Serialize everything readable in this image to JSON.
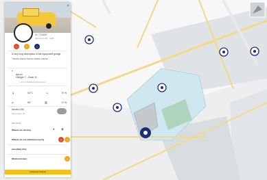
{
  "panel": {
    "close_label": "×",
    "id_line": "ID: 724487",
    "sub_line": "Airport 2.0 A56 · A238",
    "description_1": "A very long description of the equipment goinge",
    "description_2": "Tractor tractor tractor tractor tractor…",
    "location_1": "Apron",
    "location_2": "Hangar 7 - Dock 11",
    "last_updated": "LAST UPDATED 9 HOURS AGO",
    "stats": [
      {
        "label": "52°C",
        "value": "79 %"
      },
      {
        "label": "90°",
        "value": "17 %"
      }
    ],
    "issues_label": "Issues (45)",
    "issues_sub": "New Issues: 34",
    "required_label": "REQUIRED",
    "items": [
      {
        "label": "Wheels are missing"
      },
      {
        "label": "Wheels are not attached properly"
      },
      {
        "label": "Incredibly dirty"
      },
      {
        "label": "Window broken"
      }
    ],
    "footer_label": "Lufthansa Technik"
  },
  "colors": {
    "accent": "#f2c21a",
    "alert_red": "#e04a2d",
    "marker_blue": "#1c2d7a"
  }
}
